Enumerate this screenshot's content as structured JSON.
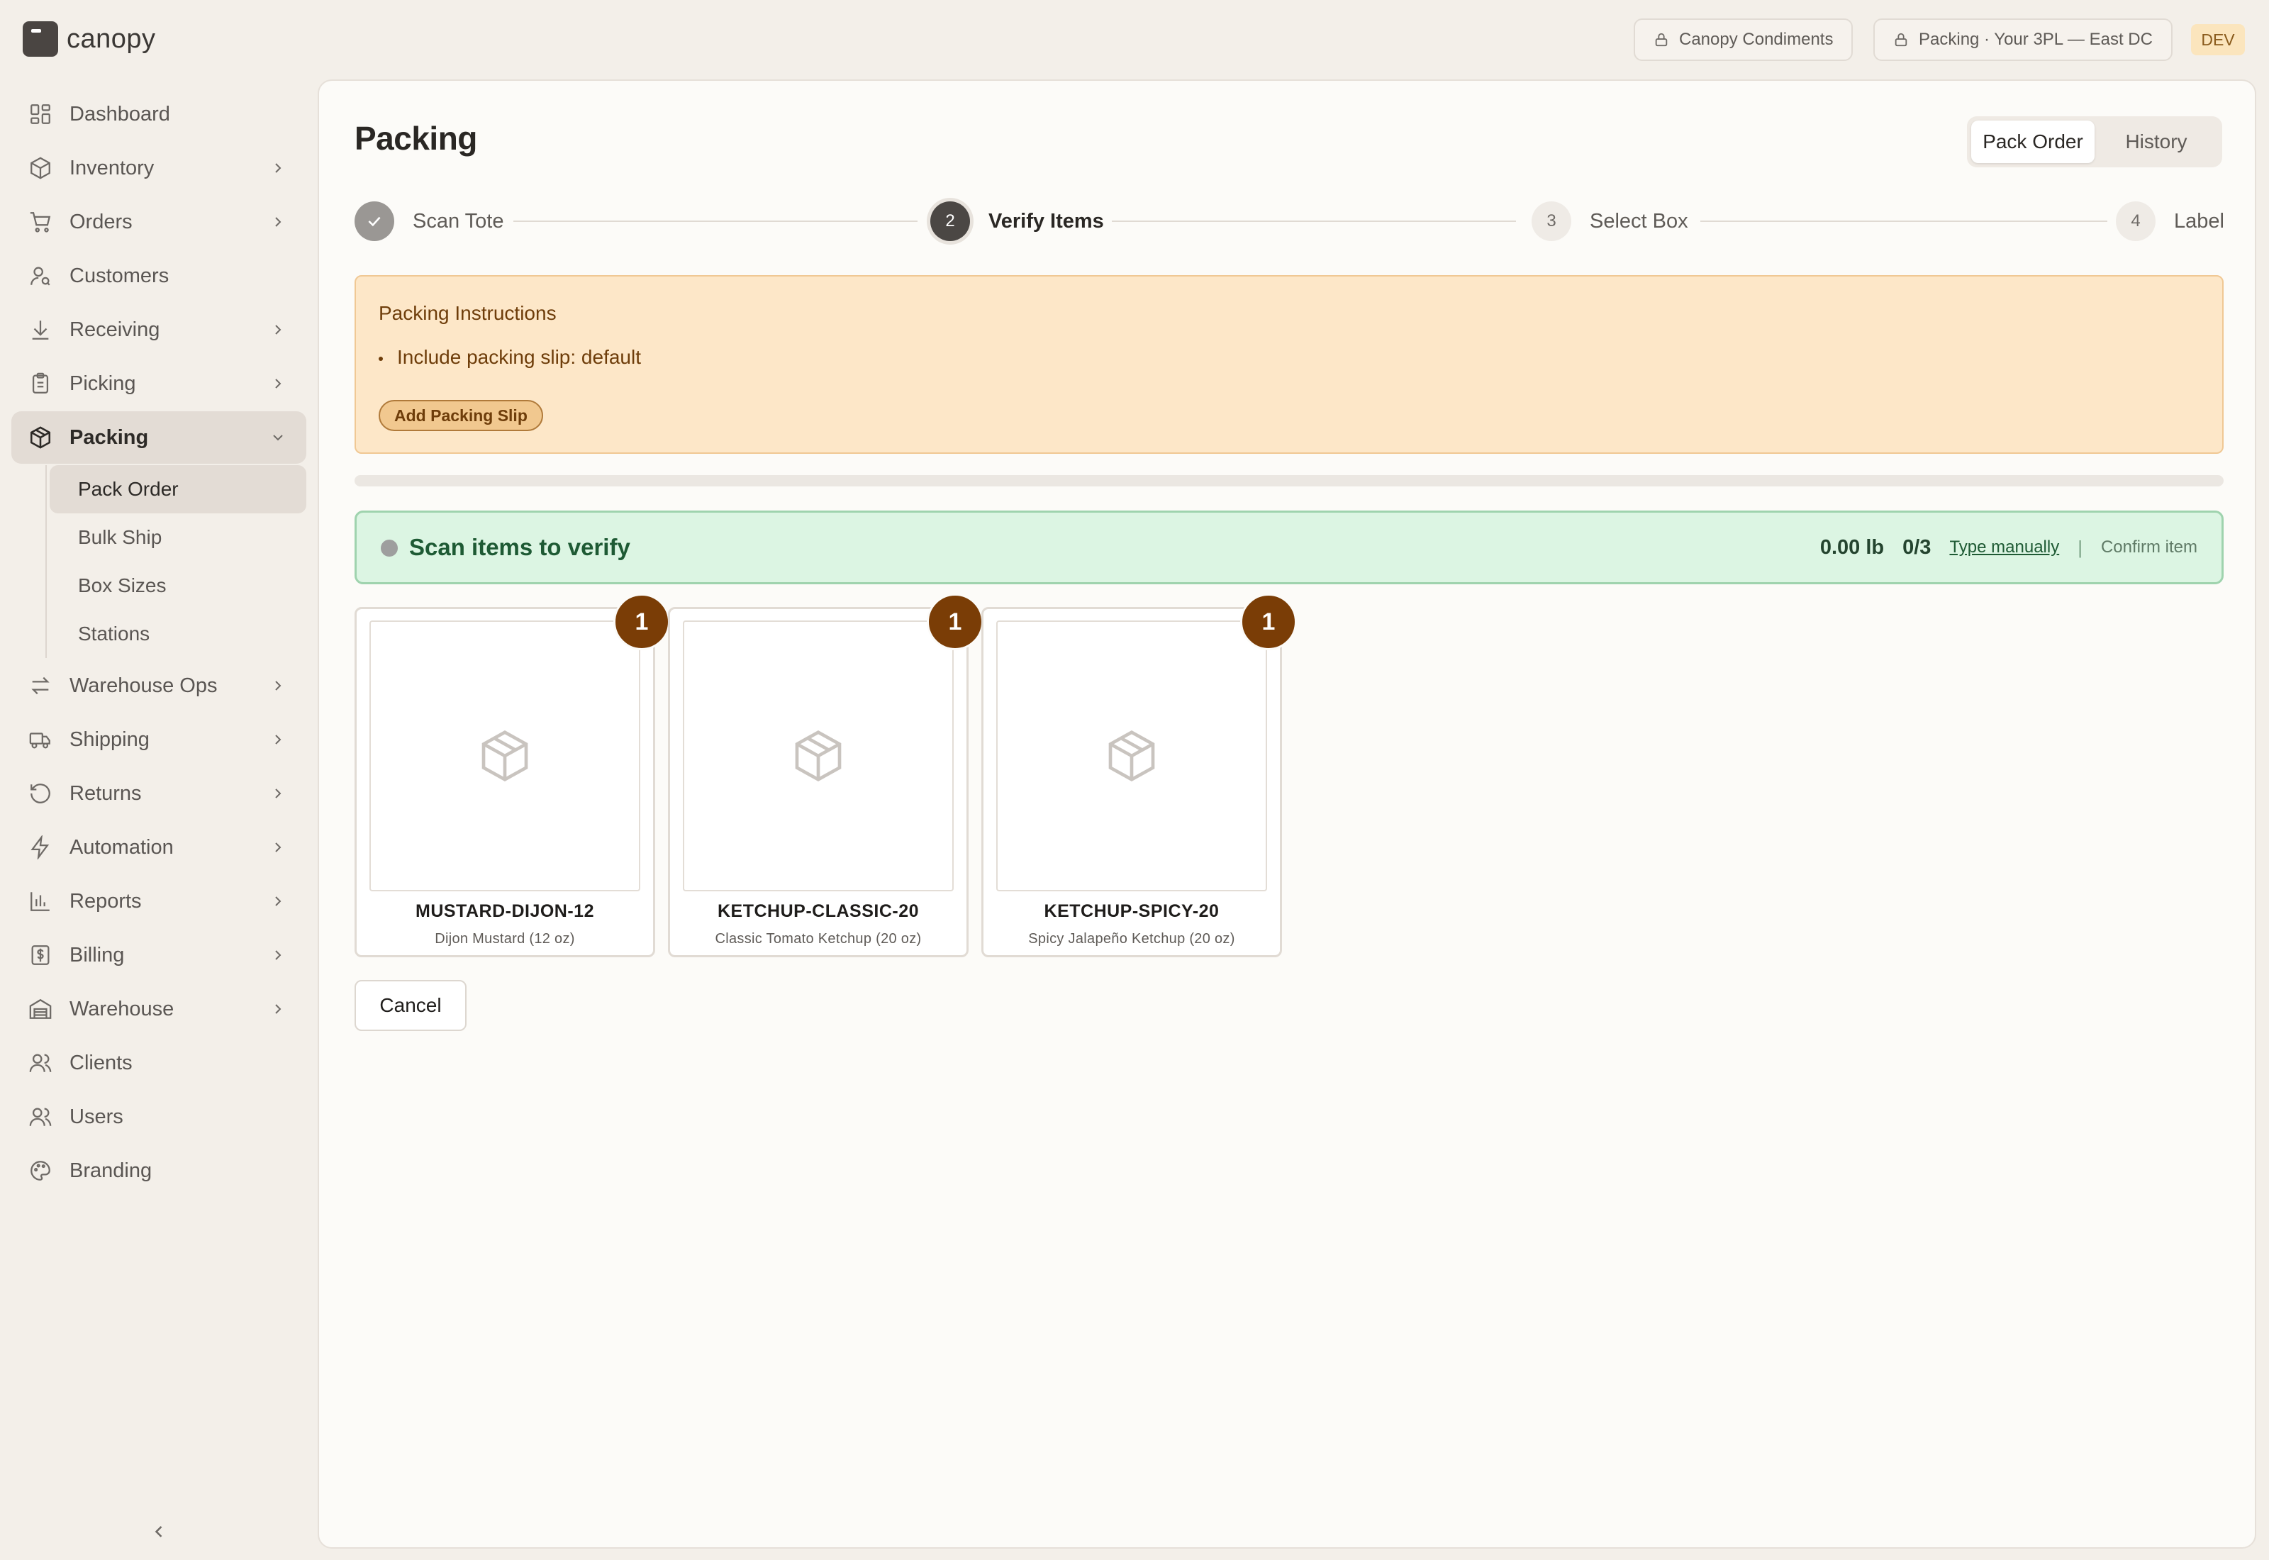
{
  "brand": {
    "name": "canopy"
  },
  "topbar": {
    "client_label": "Canopy Condiments",
    "context_label": "Packing · Your 3PL — East DC",
    "env_badge": "DEV"
  },
  "sidebar": {
    "items": [
      {
        "label": "Dashboard",
        "icon": "dashboard-icon"
      },
      {
        "label": "Inventory",
        "icon": "box-icon"
      },
      {
        "label": "Orders",
        "icon": "cart-icon"
      },
      {
        "label": "Customers",
        "icon": "customer-icon"
      },
      {
        "label": "Receiving",
        "icon": "download-icon"
      },
      {
        "label": "Picking",
        "icon": "clipboard-icon"
      },
      {
        "label": "Packing",
        "icon": "package-icon"
      },
      {
        "label": "Warehouse Ops",
        "icon": "arrows-icon"
      },
      {
        "label": "Shipping",
        "icon": "truck-icon"
      },
      {
        "label": "Returns",
        "icon": "return-icon"
      },
      {
        "label": "Automation",
        "icon": "lightning-icon"
      },
      {
        "label": "Reports",
        "icon": "bar-chart-icon"
      },
      {
        "label": "Billing",
        "icon": "dollar-icon"
      },
      {
        "label": "Warehouse",
        "icon": "warehouse-icon"
      },
      {
        "label": "Clients",
        "icon": "users-icon"
      },
      {
        "label": "Users",
        "icon": "users-icon"
      },
      {
        "label": "Branding",
        "icon": "palette-icon"
      }
    ],
    "packing_sub": [
      "Pack Order",
      "Bulk Ship",
      "Box Sizes",
      "Stations"
    ]
  },
  "page": {
    "title": "Packing",
    "tabs": [
      "Pack Order",
      "History"
    ],
    "active_tab": "Pack Order"
  },
  "stepper": {
    "steps": [
      {
        "num": "1",
        "label": "Scan Tote",
        "state": "done"
      },
      {
        "num": "2",
        "label": "Verify Items",
        "state": "current"
      },
      {
        "num": "3",
        "label": "Select Box",
        "state": "todo"
      },
      {
        "num": "4",
        "label": "Label",
        "state": "todo"
      }
    ]
  },
  "instructions": {
    "title": "Packing Instructions",
    "bullets": [
      "Include packing slip: default"
    ],
    "button": "Add Packing Slip"
  },
  "progress": {
    "fraction": 0
  },
  "scan": {
    "status": "Scan items to verify",
    "weight": "0.00 lb",
    "count": "0/3",
    "manual_link": "Type manually",
    "separator": "|",
    "confirm": "Confirm item"
  },
  "items": [
    {
      "sku": "MUSTARD-DIJON-12",
      "name": "Dijon Mustard (12 oz)",
      "qty": "1"
    },
    {
      "sku": "KETCHUP-CLASSIC-20",
      "name": "Classic Tomato Ketchup (20 oz)",
      "qty": "1"
    },
    {
      "sku": "KETCHUP-SPICY-20",
      "name": "Spicy Jalapeño Ketchup (20 oz)",
      "qty": "1"
    }
  ],
  "actions": {
    "cancel": "Cancel"
  },
  "colors": {
    "accent_brown": "#7a3d06",
    "instructions_bg": "#fde7c8",
    "scan_bg": "#dcf5e3",
    "dev_badge_bg": "#fbe5bd"
  }
}
